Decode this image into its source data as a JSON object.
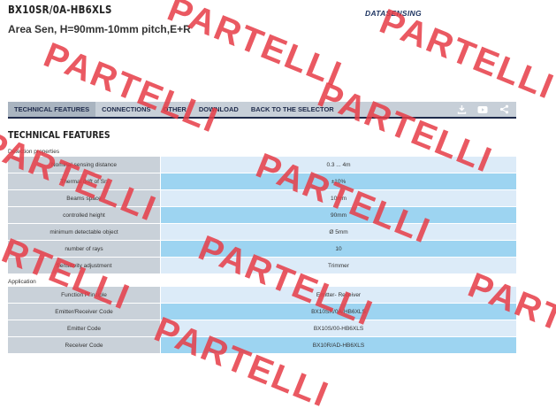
{
  "header": {
    "product_code": "BX10SR/0A-HB6XLS",
    "subtitle": "Area Sen, H=90mm-10mm pitch,E+R",
    "logo_text": "DATASENSING"
  },
  "nav": {
    "items": [
      {
        "label": "TECHNICAL FEATURES"
      },
      {
        "label": "CONNECTIONS"
      },
      {
        "label": "OTHER"
      },
      {
        "label": "DOWNLOAD"
      },
      {
        "label": "BACK TO THE SELECTOR"
      }
    ],
    "icons": [
      "download-icon",
      "video-icon",
      "share-icon"
    ]
  },
  "section_title": "TECHNICAL FEATURES",
  "groups": [
    {
      "label": "Detection properties",
      "rows": [
        {
          "name": "Nominal sensing distance",
          "value": "0.3 ... 4m"
        },
        {
          "name": "Thermal drift of Sn",
          "value": "±10%"
        },
        {
          "name": "Beams space",
          "value": "10mm"
        },
        {
          "name": "controlled height",
          "value": "90mm"
        },
        {
          "name": "minimum detectable object",
          "value": "Ø 5mm"
        },
        {
          "name": "number of rays",
          "value": "10"
        },
        {
          "name": "Sensitivity adjustment",
          "value": "Trimmer"
        }
      ]
    },
    {
      "label": "Application",
      "rows": [
        {
          "name": "Function Principle",
          "value": "Emitter- Receiver"
        },
        {
          "name": "Emitter/Receiver Code",
          "value": "BX10SR/0A-HB6XLS"
        },
        {
          "name": "Emitter Code",
          "value": "BX10S/00-HB6XLS"
        },
        {
          "name": "Receiver Code",
          "value": "BX10R/AD-HB6XLS"
        }
      ]
    }
  ],
  "watermark": "PARTELLI",
  "colors": {
    "nav_bg": "#c7cfd8",
    "nav_accent": "#1e2a4a",
    "value_light": "#dcebf8",
    "value_blue": "#9dd4f1",
    "name_bg": "#c9d1d9",
    "watermark": "#e63c46"
  }
}
